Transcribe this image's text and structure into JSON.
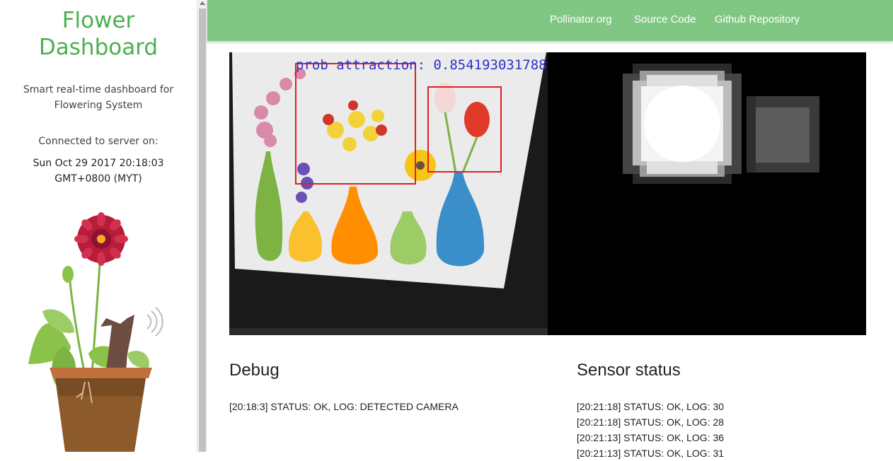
{
  "sidebar": {
    "title_line1": "Flower",
    "title_line2": "Dashboard",
    "subtitle_line1": "Smart real-time dashboard for",
    "subtitle_line2": "Flowering System",
    "connected_label": "Connected to server on:",
    "server_time_line1": "Sun Oct 29 2017 20:18:03",
    "server_time_line2": "GMT+0800 (MYT)"
  },
  "navbar": {
    "links": [
      "Pollinator.org",
      "Source Code",
      "Github Repository"
    ]
  },
  "camera": {
    "annotation": "prob attraction: 0.854193031788"
  },
  "debug": {
    "title": "Debug",
    "lines": [
      "[20:18:3] STATUS: OK, LOG: DETECTED CAMERA"
    ]
  },
  "sensor": {
    "title": "Sensor status",
    "lines": [
      "[20:21:18] STATUS: OK, LOG: 30",
      "[20:21:18] STATUS: OK, LOG: 28",
      "[20:21:13] STATUS: OK, LOG: 36",
      "[20:21:13] STATUS: OK, LOG: 31"
    ]
  },
  "colors": {
    "accent": "#4caf50",
    "navbar": "#81c784",
    "detection_box": "#e02020"
  }
}
